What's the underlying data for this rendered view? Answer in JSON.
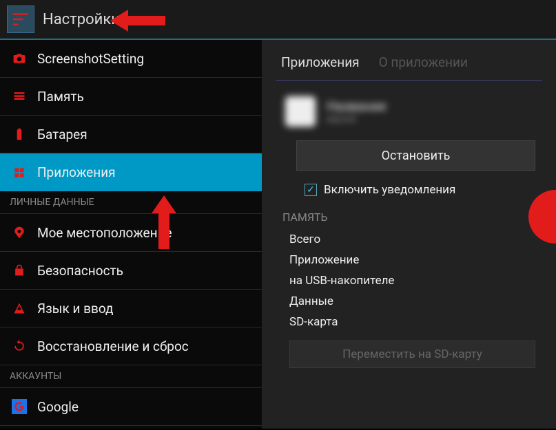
{
  "header": {
    "title": "Настройки"
  },
  "sidebar": {
    "items": [
      {
        "label": "ScreenshotSetting",
        "icon": "camera"
      },
      {
        "label": "Память",
        "icon": "storage"
      },
      {
        "label": "Батарея",
        "icon": "battery"
      },
      {
        "label": "Приложения",
        "icon": "apps",
        "selected": true
      }
    ],
    "section1": "ЛИЧНЫЕ ДАННЫЕ",
    "items2": [
      {
        "label": "Мое местоположение",
        "icon": "location"
      },
      {
        "label": "Безопасность",
        "icon": "lock"
      },
      {
        "label": "Язык и ввод",
        "icon": "language"
      },
      {
        "label": "Восстановление и сброс",
        "icon": "backup"
      }
    ],
    "section2": "АККАУНТЫ",
    "items3": [
      {
        "label": "Google",
        "icon": "google"
      }
    ]
  },
  "content": {
    "tabs": {
      "active": "Приложения",
      "inactive": "О приложении"
    },
    "app": {
      "name": "Название",
      "sub": "версия"
    },
    "stop_button": "Остановить",
    "checkbox_label": "Включить уведомления",
    "memory_header": "ПАМЯТЬ",
    "memory_rows": [
      "Всего",
      "Приложение",
      "на USB-накопителе",
      "Данные",
      "SD-карта"
    ],
    "move_button": "Переместить на SD-карту"
  }
}
